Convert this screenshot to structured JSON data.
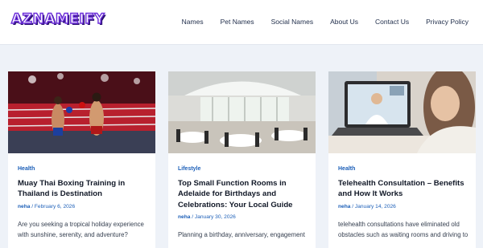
{
  "site": {
    "logo_text": "AZNAMEIFY",
    "nav": [
      "Names",
      "Pet Names",
      "Social Names",
      "About Us",
      "Contact Us",
      "Privacy Policy"
    ]
  },
  "posts": [
    {
      "category": "Health",
      "title": "Muay Thai Boxing Training in Thailand is Destination",
      "author": "neha",
      "date": "February 6, 2026",
      "excerpt": "Are you seeking a tropical holiday experience with sunshine, serenity, and adventure?",
      "image": "muay-thai-boxing-ring-photo"
    },
    {
      "category": "Lifestyle",
      "title": "Top Small Function Rooms in Adelaide for Birthdays and Celebrations: Your Local Guide",
      "author": "neha",
      "date": "January 30, 2026",
      "excerpt": "Planning a birthday, anniversary, engagement",
      "image": "function-room-photo"
    },
    {
      "category": "Health",
      "title": "Telehealth Consultation – Benefits and How It Works",
      "author": "neha",
      "date": "January 14, 2026",
      "excerpt": "telehealth consultations have eliminated old obstacles such as waiting rooms and driving to",
      "image": "telehealth-laptop-photo"
    }
  ],
  "colors": {
    "accent": "#1c5fb8",
    "logo": "#6a2bd9",
    "background": "#eef2f8"
  }
}
